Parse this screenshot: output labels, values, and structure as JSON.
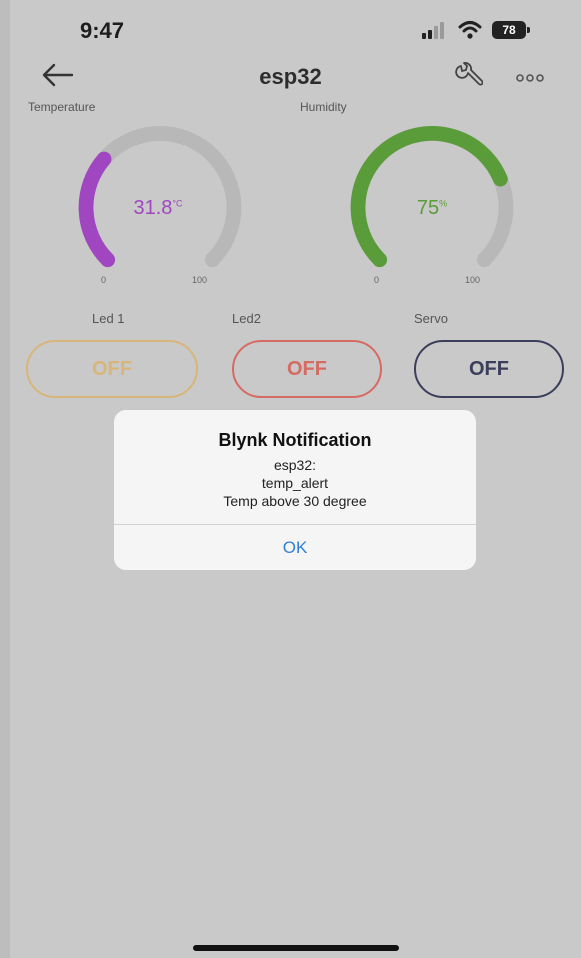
{
  "status_bar": {
    "time": "9:47",
    "battery": "78",
    "icons": [
      "signal-icon",
      "wifi-icon",
      "battery-icon"
    ]
  },
  "nav": {
    "title": "esp32",
    "icons": [
      "back-arrow-icon",
      "wrench-icon",
      "more-icon"
    ]
  },
  "gauges": [
    {
      "label": "Temperature",
      "value": "31.8",
      "unit": "°C",
      "min": "0",
      "max": "100",
      "fraction": 0.318,
      "color": "#a046c0"
    },
    {
      "label": "Humidity",
      "value": "75",
      "unit": "%",
      "min": "0",
      "max": "100",
      "fraction": 0.75,
      "color": "#5b9c3a"
    }
  ],
  "switches": [
    {
      "label": "Led 1",
      "state": "OFF",
      "color": "#d8b679"
    },
    {
      "label": "Led2",
      "state": "OFF",
      "color": "#d56b62"
    },
    {
      "label": "Servo",
      "state": "OFF",
      "color": "#3b3f5c"
    }
  ],
  "alert": {
    "title": "Blynk Notification",
    "lines": [
      "esp32:",
      "temp_alert",
      "Temp above 30 degree"
    ],
    "button": "OK"
  },
  "colors": {
    "overlay": "#c9c9c9",
    "gauge_track": "#b8b8b8",
    "link": "#2f7fd6"
  }
}
